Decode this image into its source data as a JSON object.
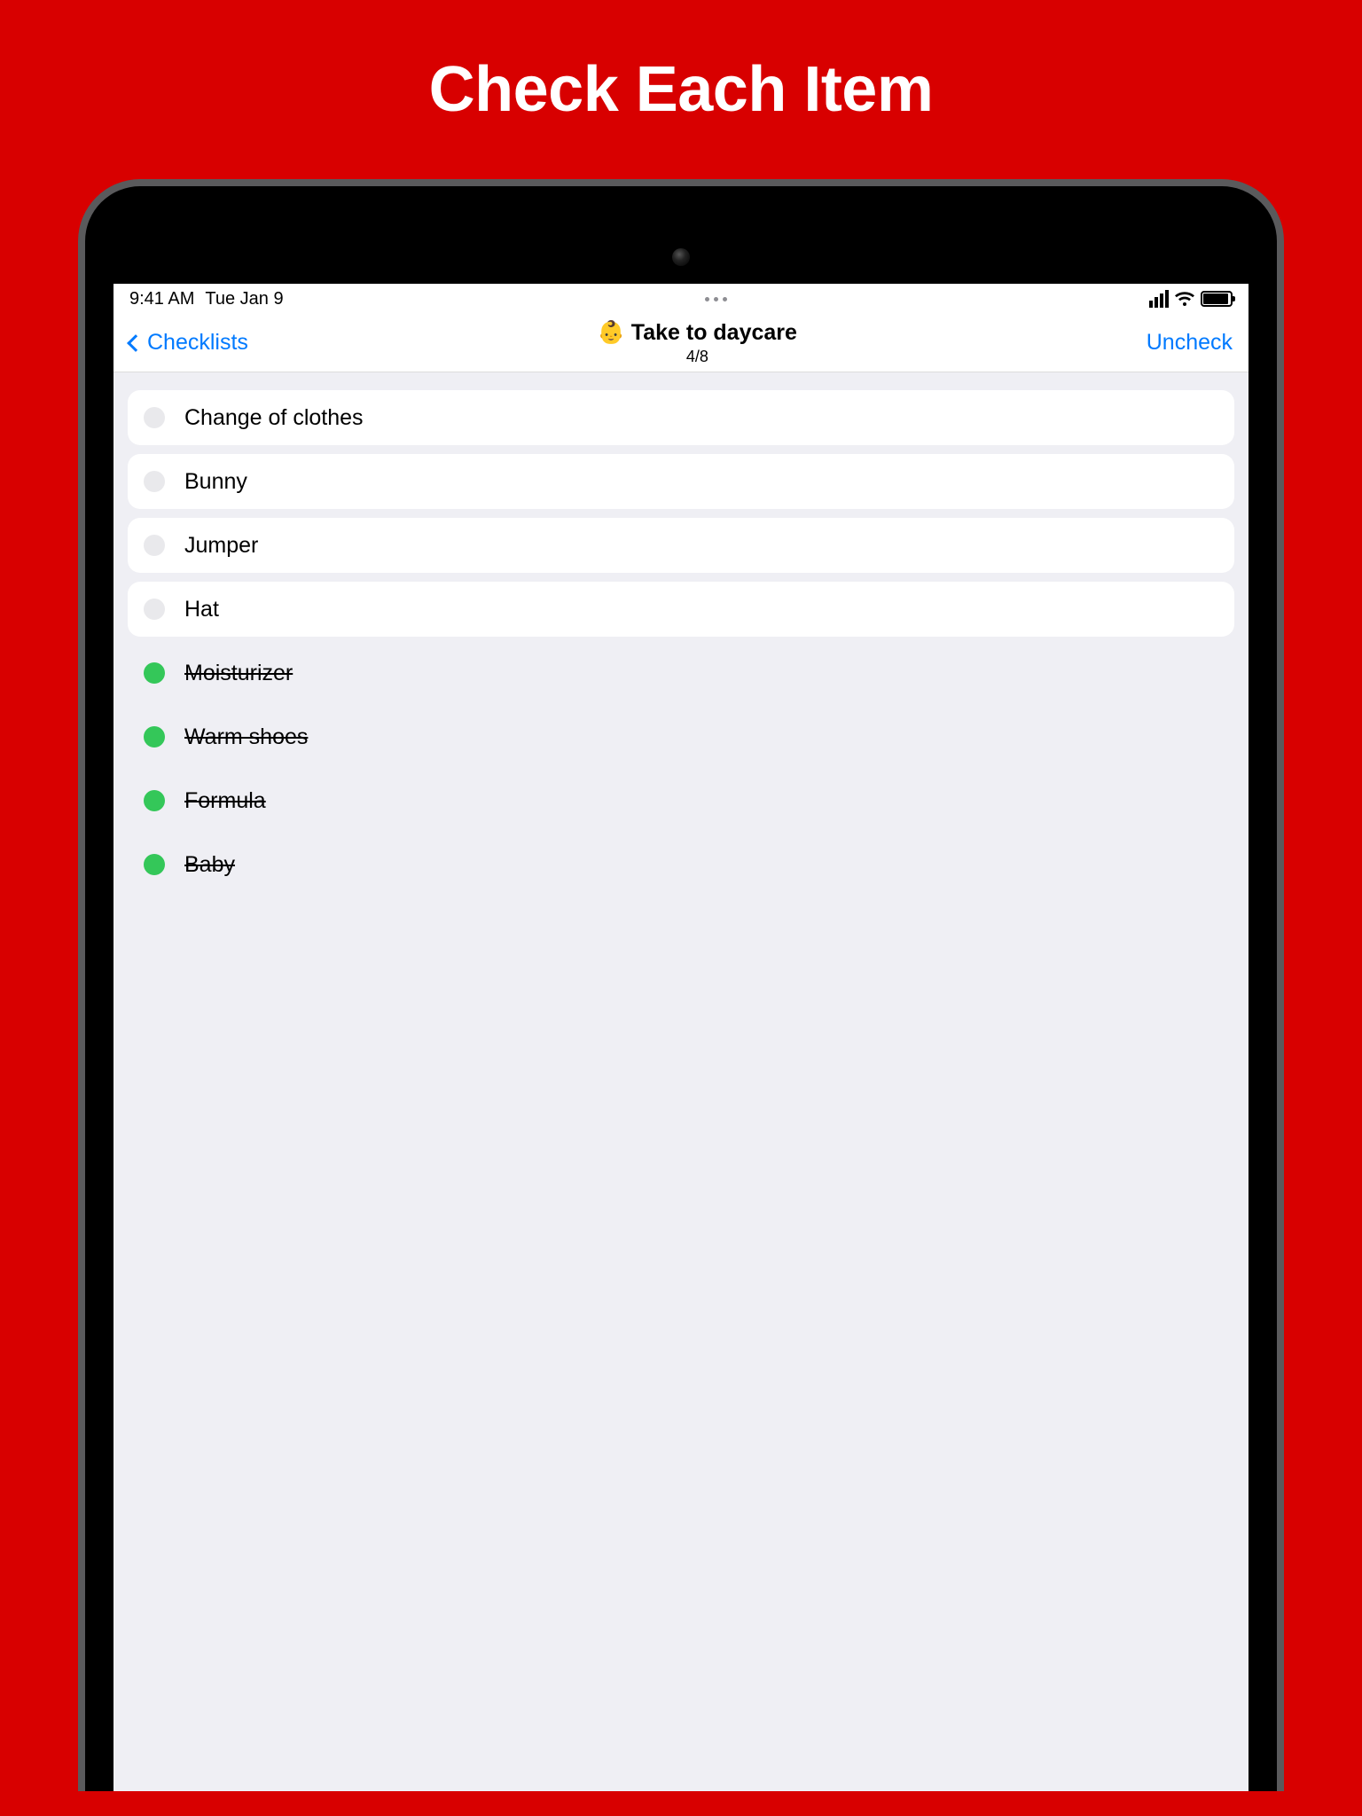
{
  "marketing": {
    "headline": "Check Each Item"
  },
  "statusBar": {
    "time": "9:41 AM",
    "date": "Tue Jan 9"
  },
  "nav": {
    "backLabel": "Checklists",
    "emoji": "👶",
    "title": "Take to daycare",
    "progress": "4/8",
    "actionLabel": "Uncheck"
  },
  "items": [
    {
      "label": "Change of clothes",
      "checked": false
    },
    {
      "label": "Bunny",
      "checked": false
    },
    {
      "label": "Jumper",
      "checked": false
    },
    {
      "label": "Hat",
      "checked": false
    },
    {
      "label": "Moisturizer",
      "checked": true
    },
    {
      "label": "Warm shoes",
      "checked": true
    },
    {
      "label": "Formula",
      "checked": true
    },
    {
      "label": "Baby",
      "checked": true
    }
  ]
}
